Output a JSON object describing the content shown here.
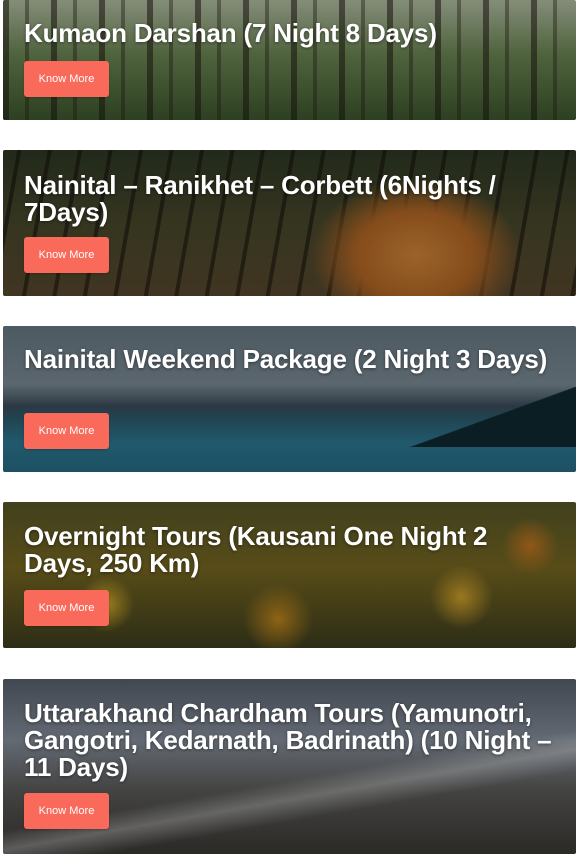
{
  "packages": [
    {
      "title": "Kumaon Darshan (7 Night 8 Days)",
      "button_label": "Know More"
    },
    {
      "title": "Nainital – Ranikhet – Corbett (6Nights / 7Days)",
      "button_label": "Know More"
    },
    {
      "title": "Nainital Weekend Package (2 Night 3 Days)",
      "button_label": "Know More"
    },
    {
      "title": "Overnight Tours (Kausani One Night 2 Days, 250 Km)",
      "button_label": "Know More"
    },
    {
      "title": "Uttarakhand Chardham Tours (Yamunotri, Gangotri, Kedarnath, Badrinath) (10 Night – 11 Days)",
      "button_label": "Know More"
    }
  ],
  "colors": {
    "button": "#f96a5b",
    "title_text": "#ffffff"
  }
}
